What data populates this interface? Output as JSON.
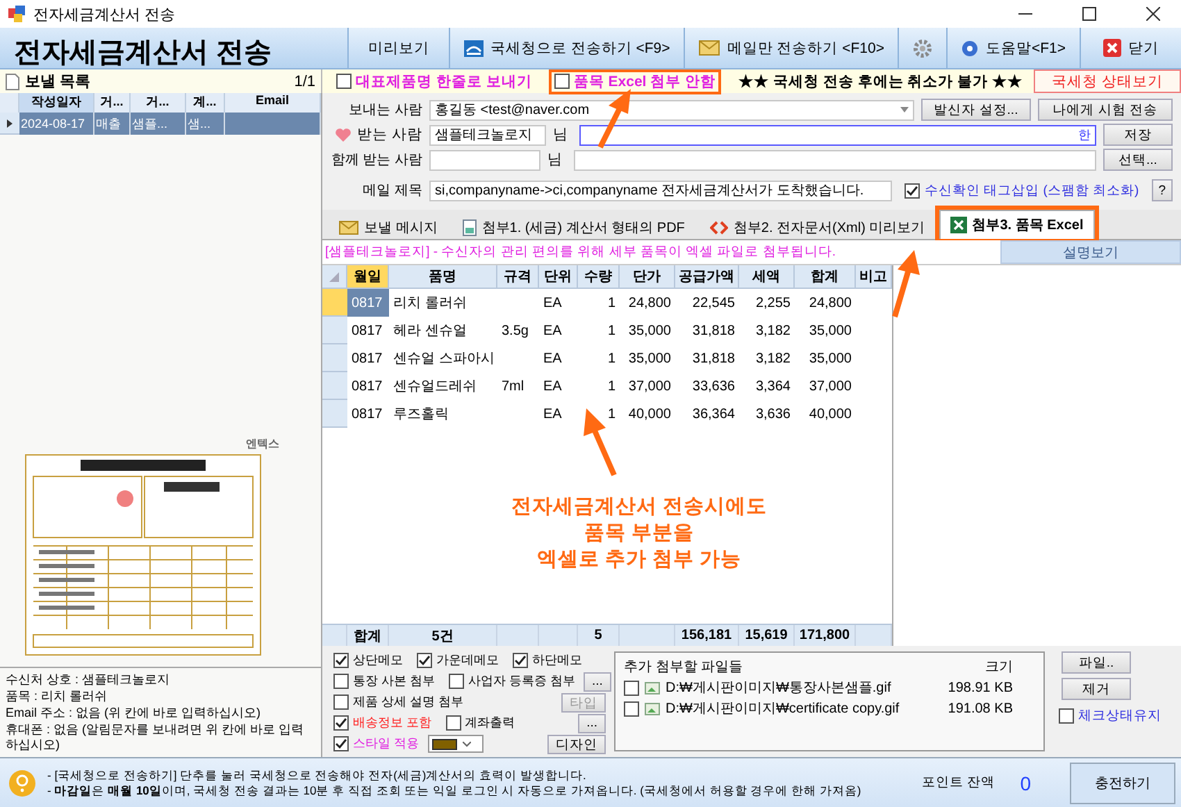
{
  "window": {
    "title": "전자세금계산서 전송"
  },
  "header": {
    "title": "전자세금계산서 전송"
  },
  "toolbar": [
    {
      "kind": "plain",
      "label": "미리보기"
    },
    {
      "kind": "send",
      "label": "국세청으로 전송하기 <F9>"
    },
    {
      "kind": "mail",
      "label": "메일만 전송하기 <F10>"
    },
    {
      "kind": "settings"
    },
    {
      "kind": "help",
      "label": "도움말<F1>"
    },
    {
      "kind": "close",
      "label": "닫기"
    }
  ],
  "send_list": {
    "title": "보낼 목록",
    "count": "1/1",
    "columns": [
      "작성일자",
      "거...",
      "거...",
      "계...",
      "Email"
    ],
    "rows": [
      {
        "cells": [
          "2024-08-17",
          "매출",
          "샘플...",
          "샘..."
        ],
        "selected": true
      }
    ]
  },
  "preview": {
    "logo": "엔텍스"
  },
  "recipient_info": [
    "수신처 상호 : 샘플테크놀로지",
    "품목 : 리치 롤러쉬",
    "Email 주소 : 없음 (위 칸에 바로 입력하십시오)",
    "휴대폰 : 없음 (알림문자를 보내려면 위 칸에 바로 입력하십시오)"
  ],
  "notice_bar": {
    "options": [
      {
        "label": "대표제품명 한줄로 보내기",
        "checked": false,
        "highlighted": false
      },
      {
        "label": "품목 Excel 첨부 안함",
        "checked": false,
        "highlighted": true
      }
    ],
    "warning": "★★ 국세청 전송 후에는 취소가 불가 ★★",
    "status_button": "국세청 상태보기"
  },
  "form": {
    "sender": {
      "label": "보내는 사람",
      "value": "홍길동 <test@naver.com",
      "buttons": [
        "발신자 설정...",
        "나에게 시험 전송"
      ]
    },
    "recipient": {
      "label": "받는 사람",
      "name": "샘플테크놀로지",
      "suffix": "님",
      "ime": "한",
      "button": "저장"
    },
    "cc": {
      "label": "함께 받는 사람",
      "suffix": "님",
      "button": "선택..."
    },
    "subject": {
      "label": "메일 제목",
      "value": "si,companyname->ci,companyname 전자세금계산서가 도착했습니다.",
      "tag_option": {
        "label": "수신확인 태그삽입 (스팸함 최소화)",
        "checked": true
      },
      "help": "?"
    }
  },
  "tabs": [
    {
      "kind": "mail",
      "label": "보낼 메시지",
      "selected": false,
      "highlighted": false
    },
    {
      "kind": "pdf",
      "label": "첨부1. (세금) 계산서 형태의 PDF",
      "selected": false,
      "highlighted": false
    },
    {
      "kind": "xml",
      "label": "첨부2. 전자문서(Xml) 미리보기",
      "selected": false,
      "highlighted": false
    },
    {
      "kind": "excel",
      "label": "첨부3. 품목 Excel",
      "selected": true,
      "highlighted": true
    }
  ],
  "tab_note": {
    "text": "[샘플테크놀로지] - 수신자의 관리 편의를 위해 세부 품목이 엑셀 파일로 첨부됩니다.",
    "button": "설명보기"
  },
  "items_table": {
    "columns": [
      "월일",
      "품명",
      "규격",
      "단위",
      "수량",
      "단가",
      "공급가액",
      "세액",
      "합계",
      "비고"
    ],
    "rows": [
      {
        "selected": true,
        "cells": [
          "0817",
          "리치 롤러쉬",
          "",
          "EA",
          "1",
          "24,800",
          "22,545",
          "2,255",
          "24,800",
          ""
        ]
      },
      {
        "selected": false,
        "cells": [
          "0817",
          "헤라 센슈얼",
          "3.5g",
          "EA",
          "1",
          "35,000",
          "31,818",
          "3,182",
          "35,000",
          ""
        ]
      },
      {
        "selected": false,
        "cells": [
          "0817",
          "센슈얼 스파아시",
          "",
          "EA",
          "1",
          "35,000",
          "31,818",
          "3,182",
          "35,000",
          ""
        ]
      },
      {
        "selected": false,
        "cells": [
          "0817",
          "센슈얼드레쉬",
          "7ml",
          "EA",
          "1",
          "37,000",
          "33,636",
          "3,364",
          "37,000",
          ""
        ]
      },
      {
        "selected": false,
        "cells": [
          "0817",
          "루즈홀릭",
          "",
          "EA",
          "1",
          "40,000",
          "36,364",
          "3,636",
          "40,000",
          ""
        ]
      }
    ],
    "totals": {
      "label": "합계",
      "count": "5건",
      "quantity": "5",
      "supply": "156,181",
      "tax": "15,619",
      "total": "171,800"
    }
  },
  "options": [
    [
      {
        "kind": "checkbox",
        "label": "상단메모",
        "checked": true,
        "color": "#000000"
      },
      {
        "kind": "checkbox",
        "label": "가운데메모",
        "checked": true,
        "color": "#000000"
      },
      {
        "kind": "checkbox",
        "label": "하단메모",
        "checked": true,
        "color": "#000000"
      }
    ],
    [
      {
        "kind": "checkbox",
        "label": "통장 사본 첨부",
        "checked": false,
        "color": "#000000"
      },
      {
        "kind": "checkbox",
        "label": "사업자 등록증 첨부",
        "checked": false,
        "color": "#000000"
      },
      {
        "kind": "button",
        "label": "...",
        "disabled": false
      }
    ],
    [
      {
        "kind": "checkbox",
        "label": "제품 상세 설명 첨부",
        "checked": false,
        "color": "#000000"
      },
      {
        "kind": "button",
        "label": "타입",
        "disabled": true
      }
    ],
    [
      {
        "kind": "checkbox",
        "label": "배송정보 포함",
        "checked": true,
        "color": "#ff2020"
      },
      {
        "kind": "checkbox",
        "label": "계좌출력",
        "checked": false,
        "color": "#000000"
      },
      {
        "kind": "button",
        "label": "...",
        "disabled": false
      }
    ],
    [
      {
        "kind": "checkbox",
        "label": "스타일 적용",
        "checked": true,
        "color": "#e020e0"
      },
      {
        "kind": "swatch",
        "color": "#806000"
      },
      {
        "kind": "button",
        "label": "디자인",
        "disabled": false
      }
    ]
  ],
  "attachments": {
    "title": "추가 첨부할 파일들",
    "size_header": "크기",
    "files": [
      {
        "name": "D:₩게시판이미지₩통장사본샘플.gif",
        "size": "198.91 KB",
        "checked": false
      },
      {
        "name": "D:₩게시판이미지₩certificate copy.gif",
        "size": "191.08 KB",
        "checked": false
      }
    ],
    "buttons": [
      "파일..",
      "제거"
    ],
    "keep_option": {
      "label": "체크상태유지",
      "checked": false
    }
  },
  "footer": {
    "lines": [
      "- [국세청으로 전송하기] 단추를 눌러 국세청으로 전송해야 전자(세금)계산서의 효력이 발생합니다.",
      "- **마감일**은 **매월 10일**이며, 국세청 전송 결과는 10분 후 직접 조회 또는 익일 로그인 시 자동으로 가져옵니다. (국세청에서 허용할 경우에 한해 가져옴)"
    ],
    "point_label": "포인트 잔액",
    "point_value": "0",
    "charge_button": "충전하기"
  },
  "annotation": {
    "lines": [
      "전자세금계산서 전송시에도",
      "품목 부분을",
      "엑셀로 추가 첨부 가능"
    ]
  }
}
